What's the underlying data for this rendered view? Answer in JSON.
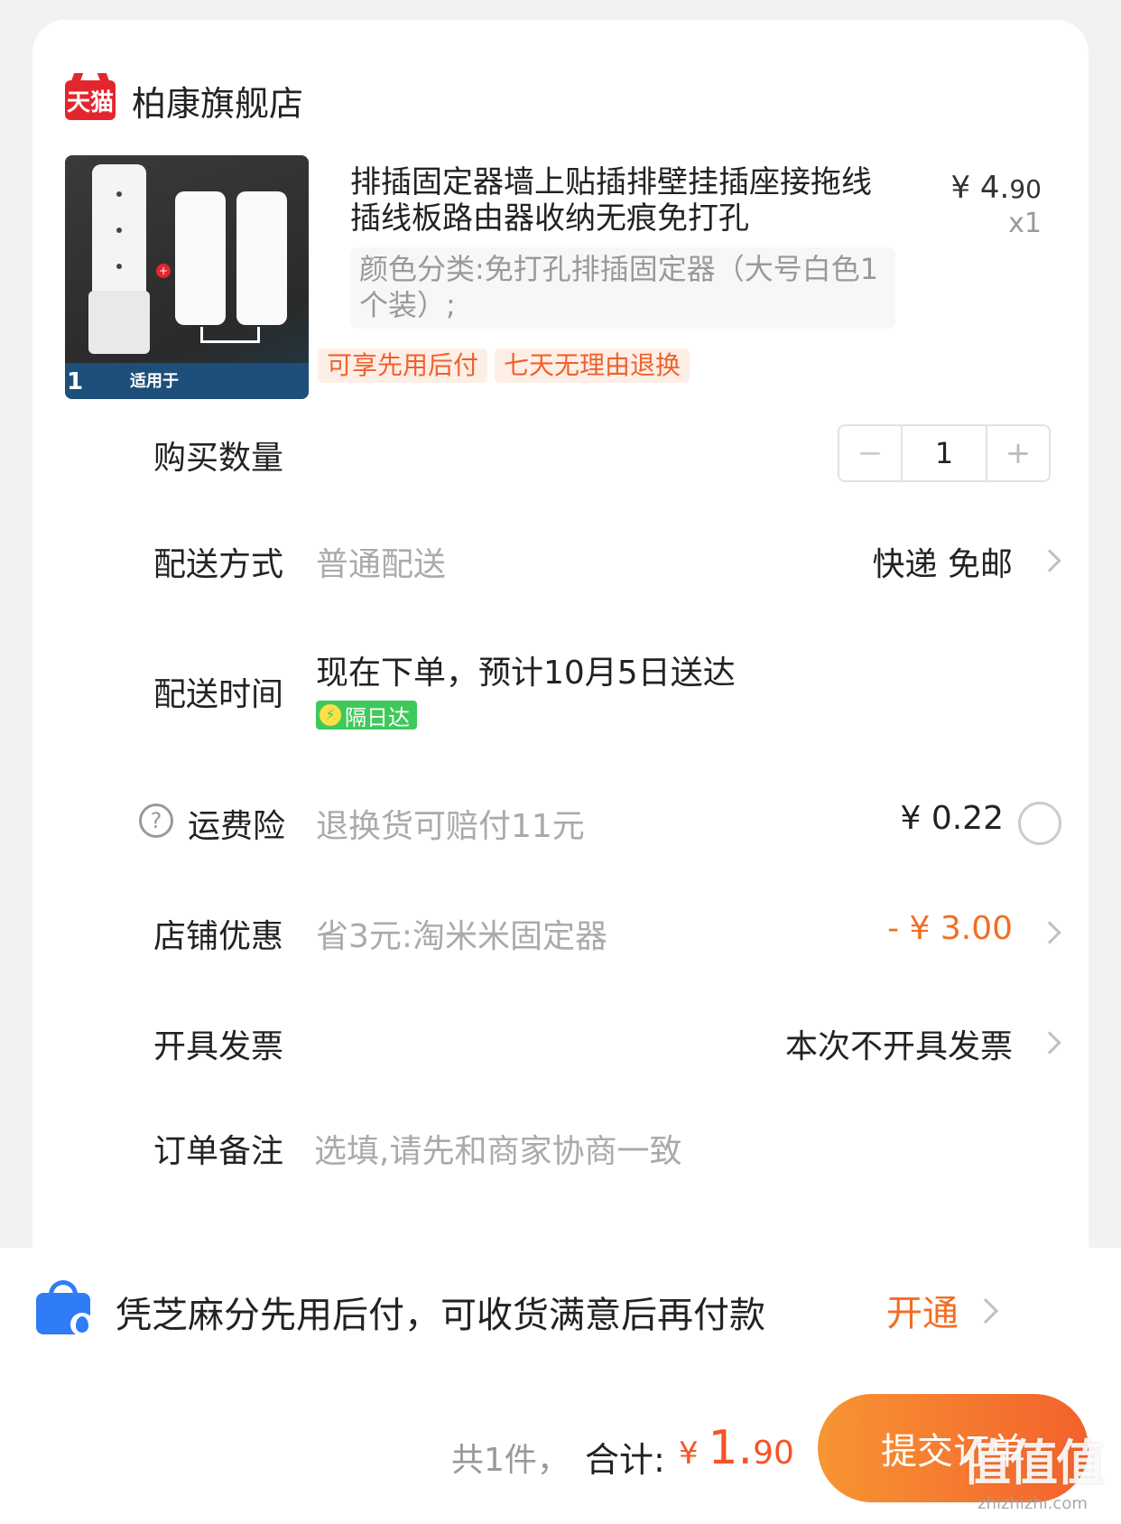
{
  "shop": {
    "platform_logo_text": "天猫",
    "name": "柏康旗舰店"
  },
  "product": {
    "title": "排插固定器墙上贴插排壁挂插座接拖线插线板路由器收纳无痕免打孔",
    "price_int": "¥ 4.",
    "price_dec": "90",
    "quantity": "x1",
    "sku": "颜色分类:免打孔排插固定器（大号白色1个装）;",
    "tags": [
      "可享先用后付",
      "七天无理由退换"
    ],
    "image_text": {
      "badge": "1",
      "caption": "适用于"
    }
  },
  "rows": {
    "quantity": {
      "label": "购买数量",
      "minus": "−",
      "value": "1",
      "plus": "+"
    },
    "shipping": {
      "label": "配送方式",
      "sub": "普通配送",
      "value": "快递 免邮"
    },
    "delivery_time": {
      "label": "配送时间",
      "value": "现在下单，预计10月5日送达",
      "badge": "隔日达"
    },
    "freight_insurance": {
      "label": "运费险",
      "help": "?",
      "sub": "退换货可赔付11元",
      "value": "¥ 0.22"
    },
    "store_discount": {
      "label": "店铺优惠",
      "sub": "省3元:淘米米固定器",
      "value": "- ¥ 3.00"
    },
    "invoice": {
      "label": "开具发票",
      "value": "本次不开具发票"
    },
    "note": {
      "label": "订单备注",
      "placeholder": "选填,请先和商家协商一致"
    }
  },
  "promo": {
    "text": "凭芝麻分先用后付，可收货满意后再付款",
    "action": "开通"
  },
  "footer": {
    "count": "共1件，",
    "total_label": "合计:",
    "total_yen": "¥ ",
    "total_int": "1.",
    "total_dec": "90",
    "submit": "提交订单"
  },
  "watermark": {
    "main": "值值值",
    "sub": "zhizhizhi.com"
  },
  "colors": {
    "accent": "#f36d24",
    "price_red": "#f55327",
    "tag_bg": "#fdeee6",
    "green_badge": "#3ec95b",
    "tmall_red": "#e3262e"
  }
}
